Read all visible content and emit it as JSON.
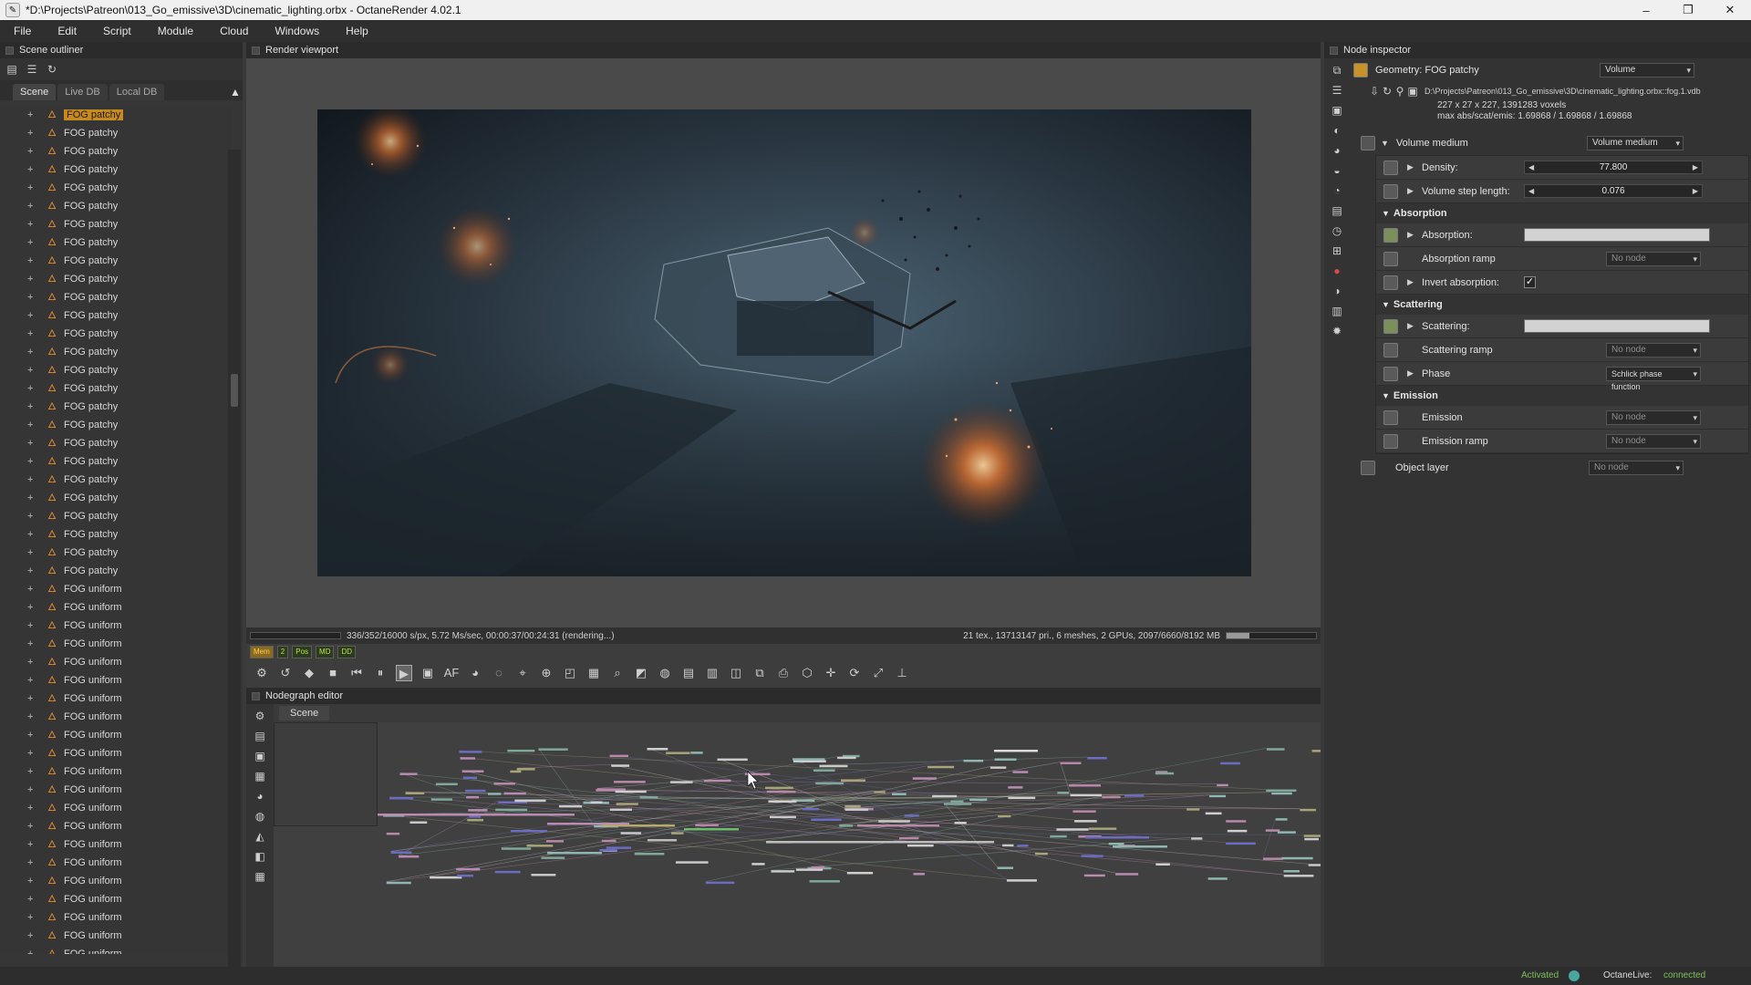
{
  "window": {
    "title": "*D:\\Projects\\Patreon\\013_Go_emissive\\3D\\cinematic_lighting.orbx - OctaneRender 4.02.1",
    "controls": [
      "–",
      "❐",
      "✕"
    ]
  },
  "menu": [
    "File",
    "Edit",
    "Script",
    "Module",
    "Cloud",
    "Windows",
    "Help"
  ],
  "outliner": {
    "title": "Scene outliner",
    "tabs": [
      "Scene",
      "Live DB",
      "Local DB"
    ],
    "items": [
      "FOG patchy",
      "FOG patchy",
      "FOG patchy",
      "FOG patchy",
      "FOG patchy",
      "FOG patchy",
      "FOG patchy",
      "FOG patchy",
      "FOG patchy",
      "FOG patchy",
      "FOG patchy",
      "FOG patchy",
      "FOG patchy",
      "FOG patchy",
      "FOG patchy",
      "FOG patchy",
      "FOG patchy",
      "FOG patchy",
      "FOG patchy",
      "FOG patchy",
      "FOG patchy",
      "FOG patchy",
      "FOG patchy",
      "FOG patchy",
      "FOG patchy",
      "FOG patchy",
      "FOG uniform",
      "FOG uniform",
      "FOG uniform",
      "FOG uniform",
      "FOG uniform",
      "FOG uniform",
      "FOG uniform",
      "FOG uniform",
      "FOG uniform",
      "FOG uniform",
      "FOG uniform",
      "FOG uniform",
      "FOG uniform",
      "FOG uniform",
      "FOG uniform",
      "FOG uniform",
      "FOG uniform",
      "FOG uniform",
      "FOG uniform",
      "FOG uniform",
      "FOG uniform"
    ],
    "cut_off_label": "FOG uniform"
  },
  "viewport": {
    "title": "Render viewport",
    "status_left": "336/352/16000 s/px, 5.72 Ms/sec, 00:00:37/00:24:31 (rendering...)",
    "status_right": "21 tex., 13713147 pri., 6 meshes, 2 GPUs, 2097/6660/8192 MB",
    "gpu_memory_fraction": 0.26,
    "badges": [
      "Mem",
      "2",
      "Pos",
      "MD",
      "DD"
    ]
  },
  "nodegraph": {
    "title": "Nodegraph editor",
    "tab": "Scene"
  },
  "inspector": {
    "title": "Node inspector",
    "geometry_label": "Geometry: FOG patchy",
    "geometry_type": "Volume",
    "file_path": "D:\\Projects\\Patreon\\013_Go_emissive\\3D\\cinematic_lighting.orbx::fog.1.vdb",
    "voxels": "227 x 27 x 227, 1391283 voxels",
    "max_values": "max abs/scat/emis: 1.69868 / 1.69868 / 1.69868",
    "medium_label": "Volume medium",
    "medium_type": "Volume medium",
    "density_label": "Density:",
    "density_value": "77.800",
    "step_label": "Volume step length:",
    "step_value": "0.076",
    "absorption_section": "Absorption",
    "absorption_label": "Absorption:",
    "absorption_ramp_label": "Absorption ramp",
    "absorption_ramp_value": "No node",
    "invert_label": "Invert absorption:",
    "invert_checked": "✓",
    "scattering_section": "Scattering",
    "scattering_label": "Scattering:",
    "scattering_ramp_label": "Scattering ramp",
    "scattering_ramp_value": "No node",
    "phase_label": "Phase",
    "phase_value": "Schlick phase function",
    "emission_section": "Emission",
    "emission_label": "Emission",
    "emission_value": "No node",
    "emission_ramp_label": "Emission ramp",
    "emission_ramp_value": "No node",
    "object_layer_label": "Object layer",
    "object_layer_value": "No node"
  },
  "statusbar": {
    "activated": "Activated",
    "octanelive": "OctaneLive:",
    "connected": "connected"
  },
  "colors": {
    "selection": "#c88a1c",
    "accent_green": "#7fc15b"
  }
}
